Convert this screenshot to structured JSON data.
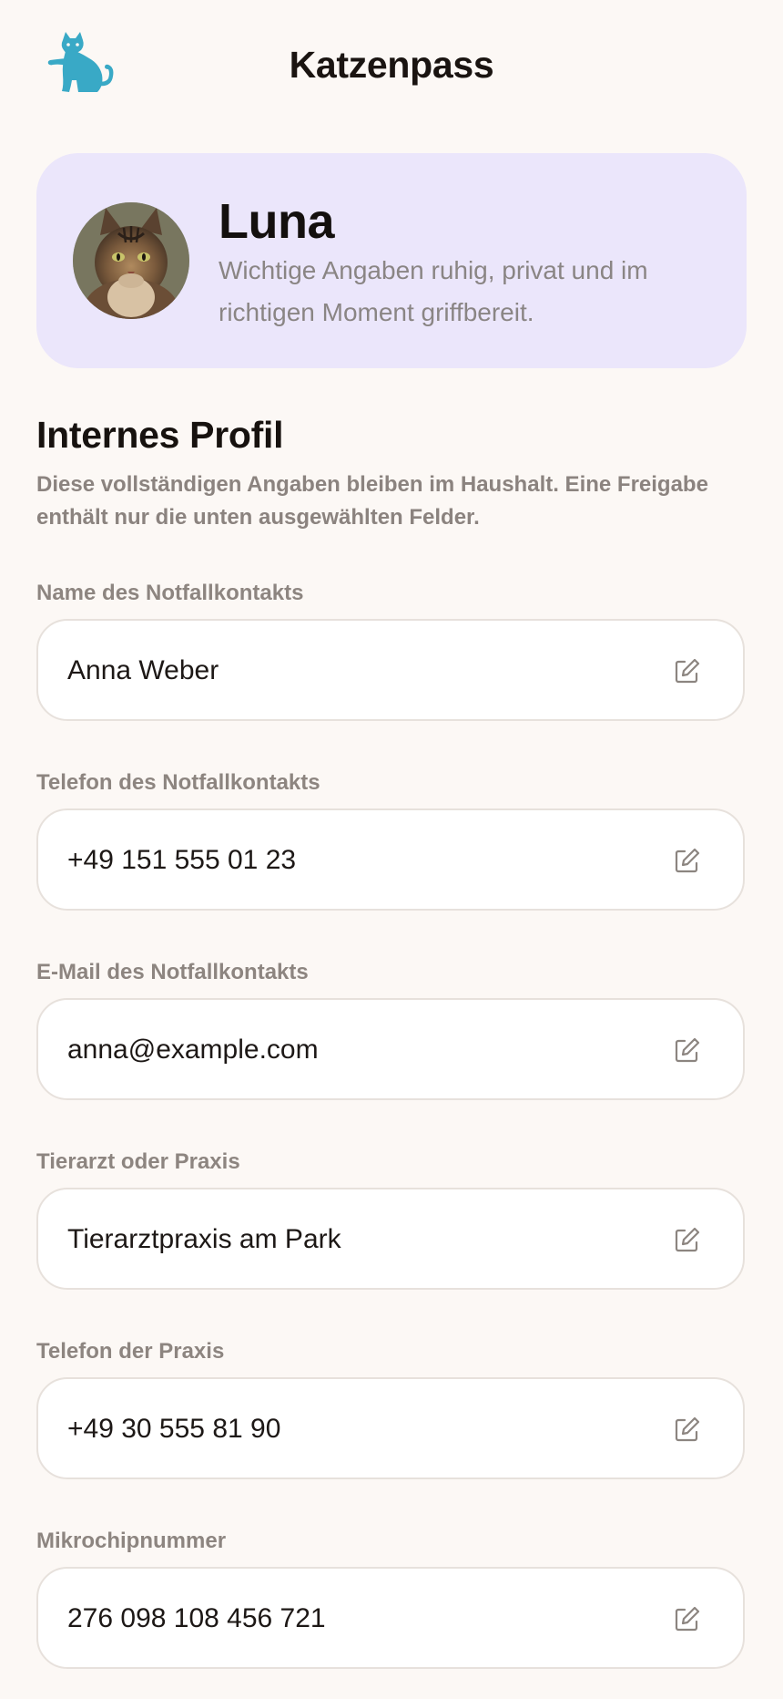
{
  "header": {
    "title": "Katzenpass",
    "logo_icon": "cat-logo-icon",
    "accent": "#39a9c6"
  },
  "hero": {
    "name": "Luna",
    "subtitle": "Wichtige Angaben ruhig, privat und im richtigen Moment griffbereit.",
    "background": "#ebe6fb"
  },
  "section": {
    "title": "Internes Profil",
    "description": "Diese vollständigen Angaben bleiben im Haushalt. Eine Freigabe enthält nur die unten ausgewählten Felder."
  },
  "fields": [
    {
      "label": "Name des Notfallkontakts",
      "value": "Anna Weber"
    },
    {
      "label": "Telefon des Notfallkontakts",
      "value": "+49 151 555 01 23"
    },
    {
      "label": "E-Mail des Notfallkontakts",
      "value": "anna@example.com"
    },
    {
      "label": "Tierarzt oder Praxis",
      "value": "Tierarztpraxis am Park"
    },
    {
      "label": "Telefon der Praxis",
      "value": "+49 30 555 81 90"
    },
    {
      "label": "Mikrochipnummer",
      "value": "276 098 108 456 721"
    }
  ],
  "edit_icon": "edit-icon"
}
